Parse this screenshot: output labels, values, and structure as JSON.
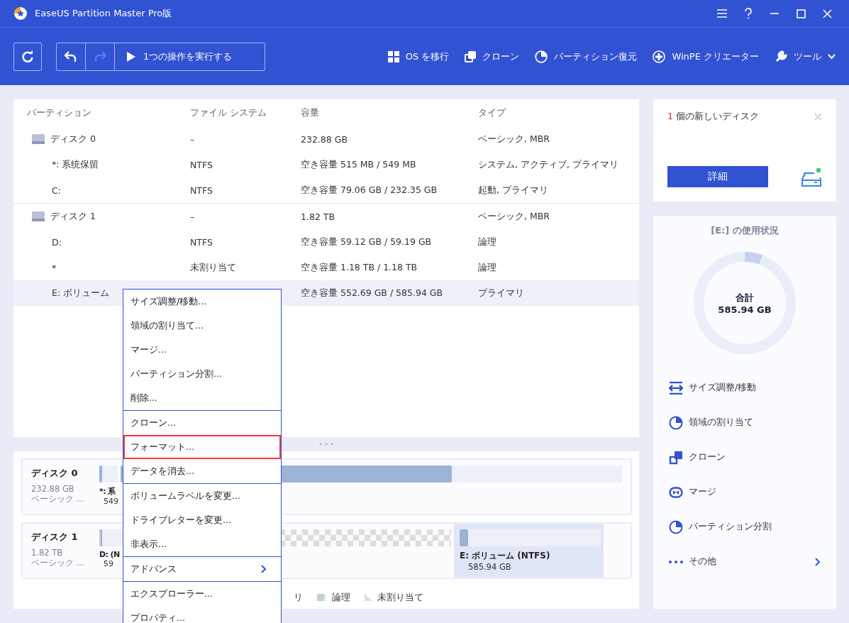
{
  "window": {
    "title": "EaseUS Partition Master Pro版"
  },
  "toolbar": {
    "run_label": "1つの操作を実行する",
    "undo_disabled": false,
    "redo_disabled": true,
    "actions": [
      {
        "kind": "windows",
        "label": "OS を移行"
      },
      {
        "kind": "clone",
        "label": "クローン"
      },
      {
        "kind": "pie",
        "label": "パーティション復元"
      },
      {
        "kind": "plus",
        "label": "WinPE クリエーター"
      },
      {
        "kind": "wrench",
        "label": "ツール",
        "dropdown": true
      }
    ]
  },
  "table": {
    "columns": [
      "パーティション",
      "ファイル システム",
      "容量",
      "タイプ"
    ],
    "rows": [
      {
        "kind": "disk",
        "cells": [
          "ディスク 0",
          "–",
          "232.88 GB",
          "ベーシック, MBR"
        ],
        "selected": false
      },
      {
        "kind": "partition",
        "cells": [
          "*: 系统保留",
          "NTFS",
          "空き容量 515 MB / 549 MB",
          "システム, アクティブ, プライマリ"
        ],
        "selected": false
      },
      {
        "kind": "partition",
        "cells": [
          "C:",
          "NTFS",
          "空き容量 79.06 GB / 232.35 GB",
          "起動, プライマリ"
        ],
        "selected": false
      },
      {
        "kind": "disk",
        "cells": [
          "ディスク 1",
          "–",
          "1.82 TB",
          "ベーシック, MBR"
        ],
        "selected": false
      },
      {
        "kind": "partition",
        "cells": [
          "D:",
          "NTFS",
          "空き容量 59.12 GB / 59.19 GB",
          "論理"
        ],
        "selected": false
      },
      {
        "kind": "partition",
        "cells": [
          "*",
          "未割り当て",
          "空き容量 1.18 TB / 1.18 TB",
          "論理"
        ],
        "selected": false
      },
      {
        "kind": "partition",
        "cells": [
          "E: ボリューム",
          "",
          "空き容量 552.69 GB / 585.94 GB",
          "プライマリ"
        ],
        "selected": true
      }
    ]
  },
  "disk_map": {
    "disks": [
      {
        "name": "ディスク 0",
        "size": "232.88 GB",
        "type": "ベーシック ...",
        "selected": false,
        "partitions": [
          {
            "kind": "primary",
            "label": "*: 系",
            "size": "549",
            "level": 0.15,
            "selected": false
          },
          {
            "kind": "primary",
            "level": 0.66,
            "selected": false
          }
        ]
      },
      {
        "name": "ディスク 1",
        "size": "1.82 TB",
        "type": "ベーシック ...",
        "selected": false,
        "partitions": [
          {
            "kind": "logical",
            "label": "D: (N",
            "size": "59",
            "level": 0.01,
            "selected": false
          },
          {
            "kind": "unallocated",
            "selected": false
          },
          {
            "kind": "primary",
            "label": "E: ボリューム (NTFS)",
            "size": "585.94 GB",
            "level": 0.06,
            "selected": true
          }
        ]
      }
    ],
    "legend": [
      {
        "kind": "primary",
        "label": "リ"
      },
      {
        "kind": "logical",
        "label": "論理"
      },
      {
        "kind": "unallocated",
        "label": "未割り当て"
      }
    ]
  },
  "context_menu": {
    "groups": [
      [
        {
          "label": "サイズ調整/移動...",
          "selected": false
        },
        {
          "label": "領域の割り当て...",
          "selected": false
        },
        {
          "label": "マージ...",
          "selected": false
        },
        {
          "label": "パーティション分割...",
          "selected": false
        },
        {
          "label": "削除...",
          "selected": false
        }
      ],
      [
        {
          "label": "クローン...",
          "selected": false
        },
        {
          "label": "フォーマット...",
          "selected": true
        },
        {
          "label": "データを消去...",
          "selected": false
        }
      ],
      [
        {
          "label": "ボリュームラベルを変更...",
          "selected": false
        },
        {
          "label": "ドライブレターを変更...",
          "selected": false
        },
        {
          "label": "非表示...",
          "selected": false
        }
      ],
      [
        {
          "label": "アドバンス",
          "selected": false,
          "submenu": true
        }
      ],
      [
        {
          "label": "エクスプローラー...",
          "selected": false
        },
        {
          "label": "プロパティ...",
          "selected": false
        }
      ]
    ]
  },
  "new_disk_card": {
    "count": "1",
    "text": "個の新しいディスク",
    "button": "詳細"
  },
  "usage": {
    "title": "[E:] の使用状況",
    "total_label": "合計",
    "total": "585.94 GB",
    "level": 0.057,
    "actions": [
      {
        "kind": "resize",
        "label": "サイズ調整/移動"
      },
      {
        "kind": "pie",
        "label": "領域の割り当て"
      },
      {
        "kind": "clone",
        "label": "クローン"
      },
      {
        "kind": "merge",
        "label": "マージ"
      },
      {
        "kind": "pie",
        "label": "パーティション分割"
      },
      {
        "kind": "more",
        "label": "その他",
        "chevron": true
      }
    ]
  }
}
